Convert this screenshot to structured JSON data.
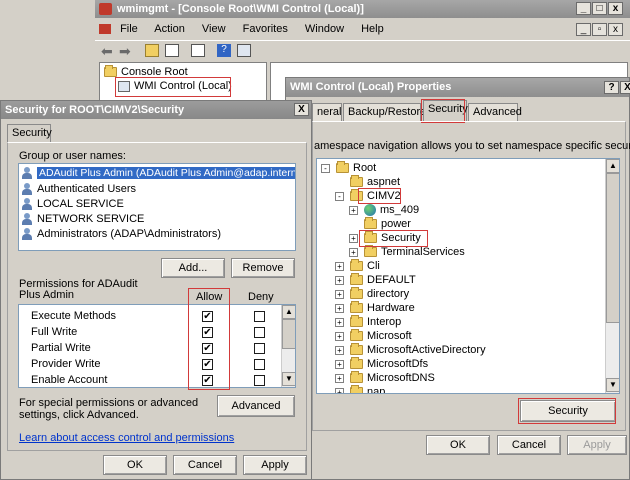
{
  "mmc": {
    "title": "wmimgmt - [Console Root\\WMI Control (Local)]",
    "menu": [
      "File",
      "Action",
      "View",
      "Favorites",
      "Window",
      "Help"
    ],
    "tree": [
      "Console Root",
      "WMI Control (Local)"
    ]
  },
  "props": {
    "title": "WMI Control (Local) Properties",
    "help_btn": "?",
    "close_btn": "X",
    "tabs": [
      "neral",
      "Backup/Restore",
      "Security",
      "Advanced"
    ],
    "description": "amespace navigation allows you to set namespace specific security.",
    "tree": [
      {
        "label": "Root",
        "indent": 0,
        "expander": "-"
      },
      {
        "label": "aspnet",
        "indent": 1,
        "expander": ""
      },
      {
        "label": "CIMV2",
        "indent": 1,
        "expander": "-"
      },
      {
        "label": "ms_409",
        "indent": 2,
        "expander": "+"
      },
      {
        "label": "power",
        "indent": 2,
        "expander": ""
      },
      {
        "label": "Security",
        "indent": 2,
        "expander": "+"
      },
      {
        "label": "TerminalServices",
        "indent": 2,
        "expander": "+"
      },
      {
        "label": "Cli",
        "indent": 1,
        "expander": "+"
      },
      {
        "label": "DEFAULT",
        "indent": 1,
        "expander": "+"
      },
      {
        "label": "directory",
        "indent": 1,
        "expander": "+"
      },
      {
        "label": "Hardware",
        "indent": 1,
        "expander": "+"
      },
      {
        "label": "Interop",
        "indent": 1,
        "expander": "+"
      },
      {
        "label": "Microsoft",
        "indent": 1,
        "expander": "+"
      },
      {
        "label": "MicrosoftActiveDirectory",
        "indent": 1,
        "expander": "+"
      },
      {
        "label": "MicrosoftDfs",
        "indent": 1,
        "expander": "+"
      },
      {
        "label": "MicrosoftDNS",
        "indent": 1,
        "expander": "+"
      },
      {
        "label": "nap",
        "indent": 1,
        "expander": "+"
      }
    ],
    "security_btn": "Security",
    "ok": "OK",
    "cancel": "Cancel",
    "apply": "Apply"
  },
  "sec": {
    "title": "Security for ROOT\\CIMV2\\Security",
    "close_btn": "X",
    "tab": "Security",
    "group_label": "Group or user names:",
    "users": [
      "ADAudit Plus Admin (ADAudit Plus Admin@adap.internal.com)",
      "Authenticated Users",
      "LOCAL SERVICE",
      "NETWORK SERVICE",
      "Administrators (ADAP\\Administrators)"
    ],
    "add_btn": "Add...",
    "remove_btn": "Remove",
    "perm_label": "Permissions for ADAudit Plus Admin",
    "allow": "Allow",
    "deny": "Deny",
    "permissions": [
      {
        "name": "Execute Methods",
        "allow": true,
        "deny": false
      },
      {
        "name": "Full Write",
        "allow": true,
        "deny": false
      },
      {
        "name": "Partial Write",
        "allow": true,
        "deny": false
      },
      {
        "name": "Provider Write",
        "allow": true,
        "deny": false
      },
      {
        "name": "Enable Account",
        "allow": true,
        "deny": false
      }
    ],
    "special_text": "For special permissions or advanced settings, click Advanced.",
    "advanced_btn": "Advanced",
    "learn_link": "Learn about access control and permissions",
    "ok": "OK",
    "cancel": "Cancel",
    "apply": "Apply"
  }
}
